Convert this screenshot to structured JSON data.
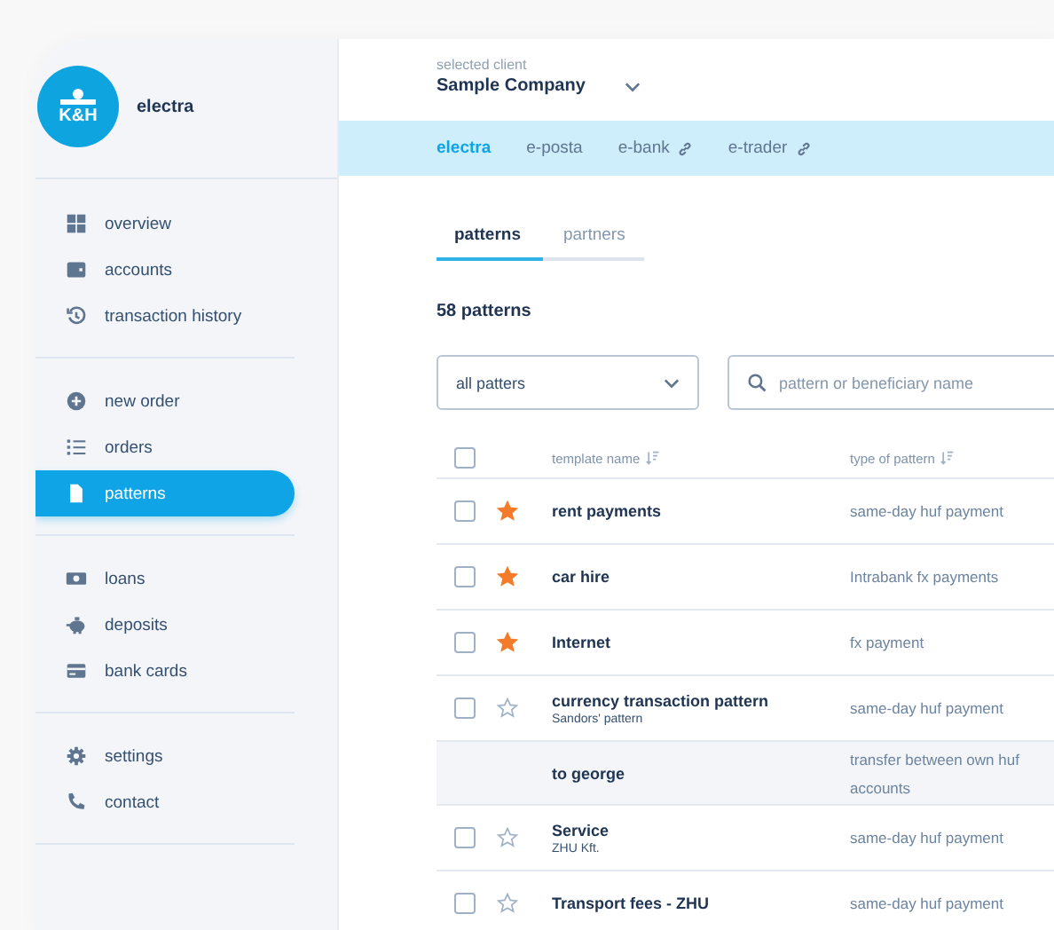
{
  "sidebar": {
    "brand": {
      "logo": "K&H",
      "name": "electra"
    },
    "groups": [
      [
        {
          "label": "overview",
          "kind": "grid",
          "selected": false
        },
        {
          "label": "accounts",
          "kind": "wallet",
          "selected": false
        },
        {
          "label": "transaction history",
          "kind": "history",
          "selected": false
        }
      ],
      [
        {
          "label": "new order",
          "kind": "plus",
          "selected": false
        },
        {
          "label": "orders",
          "kind": "list",
          "selected": false
        },
        {
          "label": "patterns",
          "kind": "file",
          "selected": true
        }
      ],
      [
        {
          "label": "loans",
          "kind": "cash",
          "selected": false
        },
        {
          "label": "deposits",
          "kind": "piggy",
          "selected": false
        },
        {
          "label": "bank cards",
          "kind": "card",
          "selected": false
        }
      ],
      [
        {
          "label": "settings",
          "kind": "gear",
          "selected": false
        },
        {
          "label": "contact",
          "kind": "phone",
          "selected": false
        }
      ]
    ]
  },
  "client": {
    "label": "selected client",
    "value": "Sample Company"
  },
  "apps": [
    {
      "label": "electra",
      "link": false,
      "selected": true
    },
    {
      "label": "e-posta",
      "link": false,
      "selected": false
    },
    {
      "label": "e-bank",
      "link": true,
      "selected": false
    },
    {
      "label": "e-trader",
      "link": true,
      "selected": false
    }
  ],
  "tabs": [
    {
      "label": "patterns",
      "selected": true
    },
    {
      "label": "partners",
      "selected": false
    }
  ],
  "count": "58 patterns",
  "filter": {
    "value": "all patters"
  },
  "search": {
    "placeholder": "pattern or beneficiary name"
  },
  "table": {
    "header_checked": false,
    "columns": [
      "template name",
      "type of pattern"
    ],
    "rows": [
      {
        "kind": "pattern",
        "checked": false,
        "starred": true,
        "highlighted": false,
        "name": "rent payments",
        "type": "same-day huf payment"
      },
      {
        "kind": "pattern",
        "checked": false,
        "starred": true,
        "highlighted": false,
        "name": "car hire",
        "type": "Intrabank fx payments"
      },
      {
        "kind": "pattern",
        "checked": false,
        "starred": true,
        "highlighted": false,
        "name": "Internet",
        "type": "fx payment"
      },
      {
        "kind": "pattern",
        "checked": false,
        "starred": false,
        "highlighted": false,
        "name": "currency transaction pattern",
        "sub": "Sandors' pattern",
        "type": "same-day huf payment"
      },
      {
        "kind": "transfer",
        "highlighted": true,
        "name": "to george",
        "type": "transfer between own huf accounts"
      },
      {
        "kind": "pattern",
        "checked": false,
        "starred": false,
        "highlighted": false,
        "name": "Service",
        "sub": "ZHU Kft.",
        "type": "same-day huf payment"
      },
      {
        "kind": "pattern",
        "checked": false,
        "starred": false,
        "highlighted": false,
        "name": "Transport fees - ZHU",
        "type": "same-day huf payment"
      }
    ]
  }
}
